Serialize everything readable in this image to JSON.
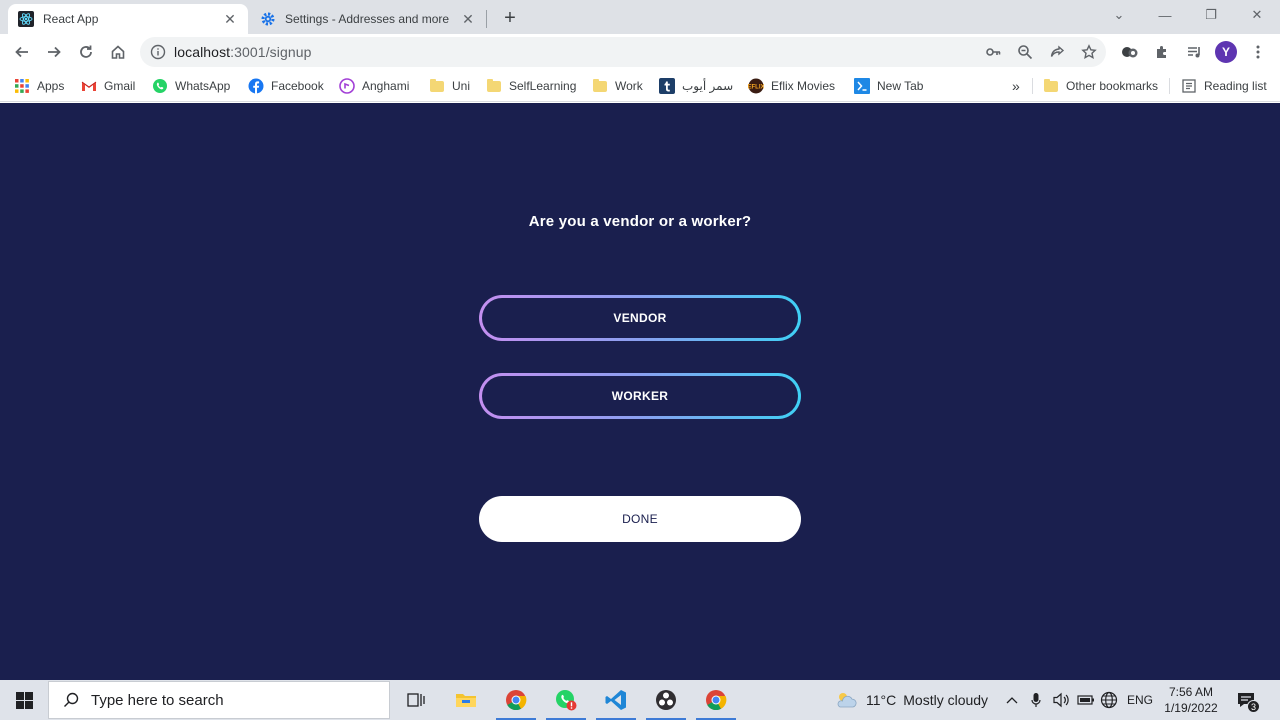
{
  "browser": {
    "tabs": [
      {
        "title": "React App",
        "active": true
      },
      {
        "title": "Settings - Addresses and more",
        "active": false
      }
    ],
    "url_host": "localhost",
    "url_path": ":3001/signup",
    "profile_initial": "Y"
  },
  "bookmarks": {
    "items": [
      "Apps",
      "Gmail",
      "WhatsApp",
      "Facebook",
      "Anghami",
      "Uni",
      "SelfLearning",
      "Work",
      "سمر أيوب",
      "Eflix Movies",
      "New Tab"
    ],
    "overflow": "»",
    "other": "Other bookmarks",
    "reading_list": "Reading list"
  },
  "page": {
    "question": "Are you a vendor or a worker?",
    "vendor_label": "VENDOR",
    "worker_label": "WORKER",
    "done_label": "DONE",
    "colors": {
      "background": "#1a1f4e",
      "gradient_start": "#c48ff0",
      "gradient_end": "#3fd0f5"
    }
  },
  "taskbar": {
    "search_placeholder": "Type here to search",
    "weather_temp": "11°C",
    "weather_text": "Mostly cloudy",
    "language": "ENG",
    "time": "7:56 AM",
    "date": "1/19/2022",
    "notification_count": "3"
  }
}
